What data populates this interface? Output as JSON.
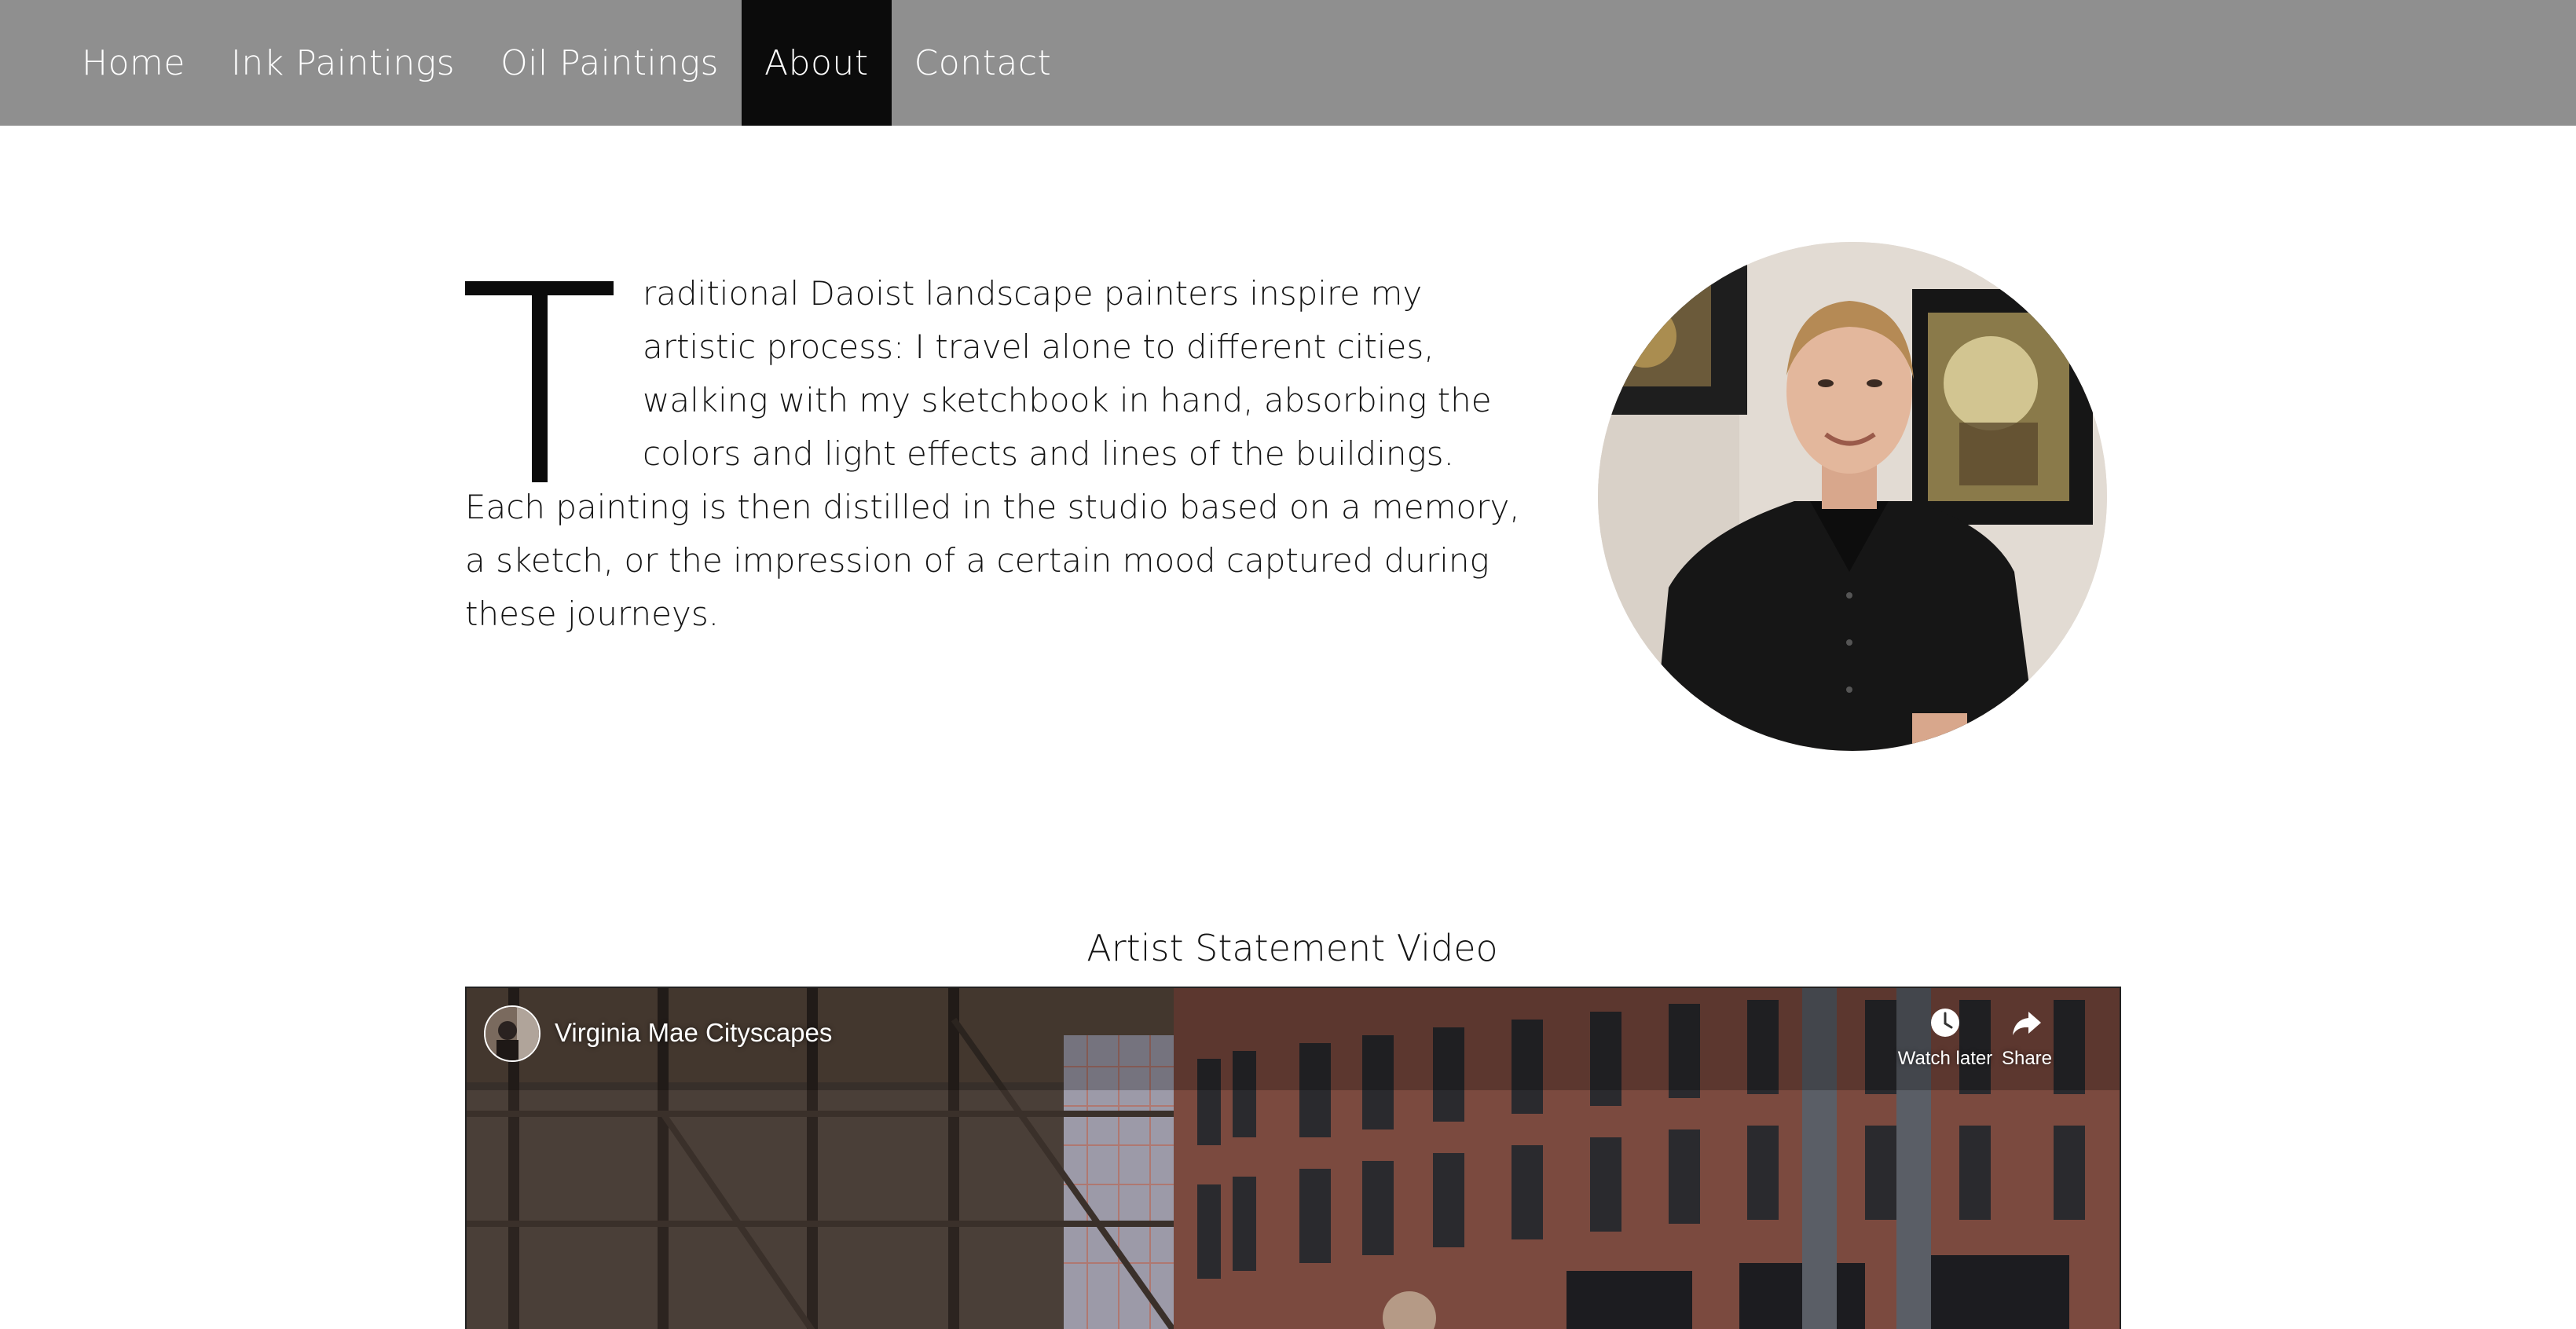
{
  "nav": {
    "items": [
      {
        "label": "Home",
        "active": false
      },
      {
        "label": "Ink Paintings",
        "active": false
      },
      {
        "label": "Oil Paintings",
        "active": false
      },
      {
        "label": "About",
        "active": true
      },
      {
        "label": "Contact",
        "active": false
      }
    ]
  },
  "intro": {
    "drop_cap": "T",
    "text": "raditional Daoist landscape painters inspire my artistic process: I travel alone to different cities, walking with my sketchbook in hand, absorbing the colors and light effects and lines of the buildings.  Each painting is then distilled in the studio based on a memory, a sketch, or the impression of a certain mood captured during these journeys."
  },
  "video": {
    "section_title": "Artist Statement Video",
    "channel_name": "Virginia Mae Cityscapes",
    "watch_later_label": "Watch later",
    "share_label": "Share"
  },
  "colors": {
    "nav_background": "#8f8f8f",
    "nav_active_background": "#0b0b0b",
    "text": "#141414"
  },
  "icons": {
    "watch_later": "clock-icon",
    "share": "share-arrow-icon"
  }
}
